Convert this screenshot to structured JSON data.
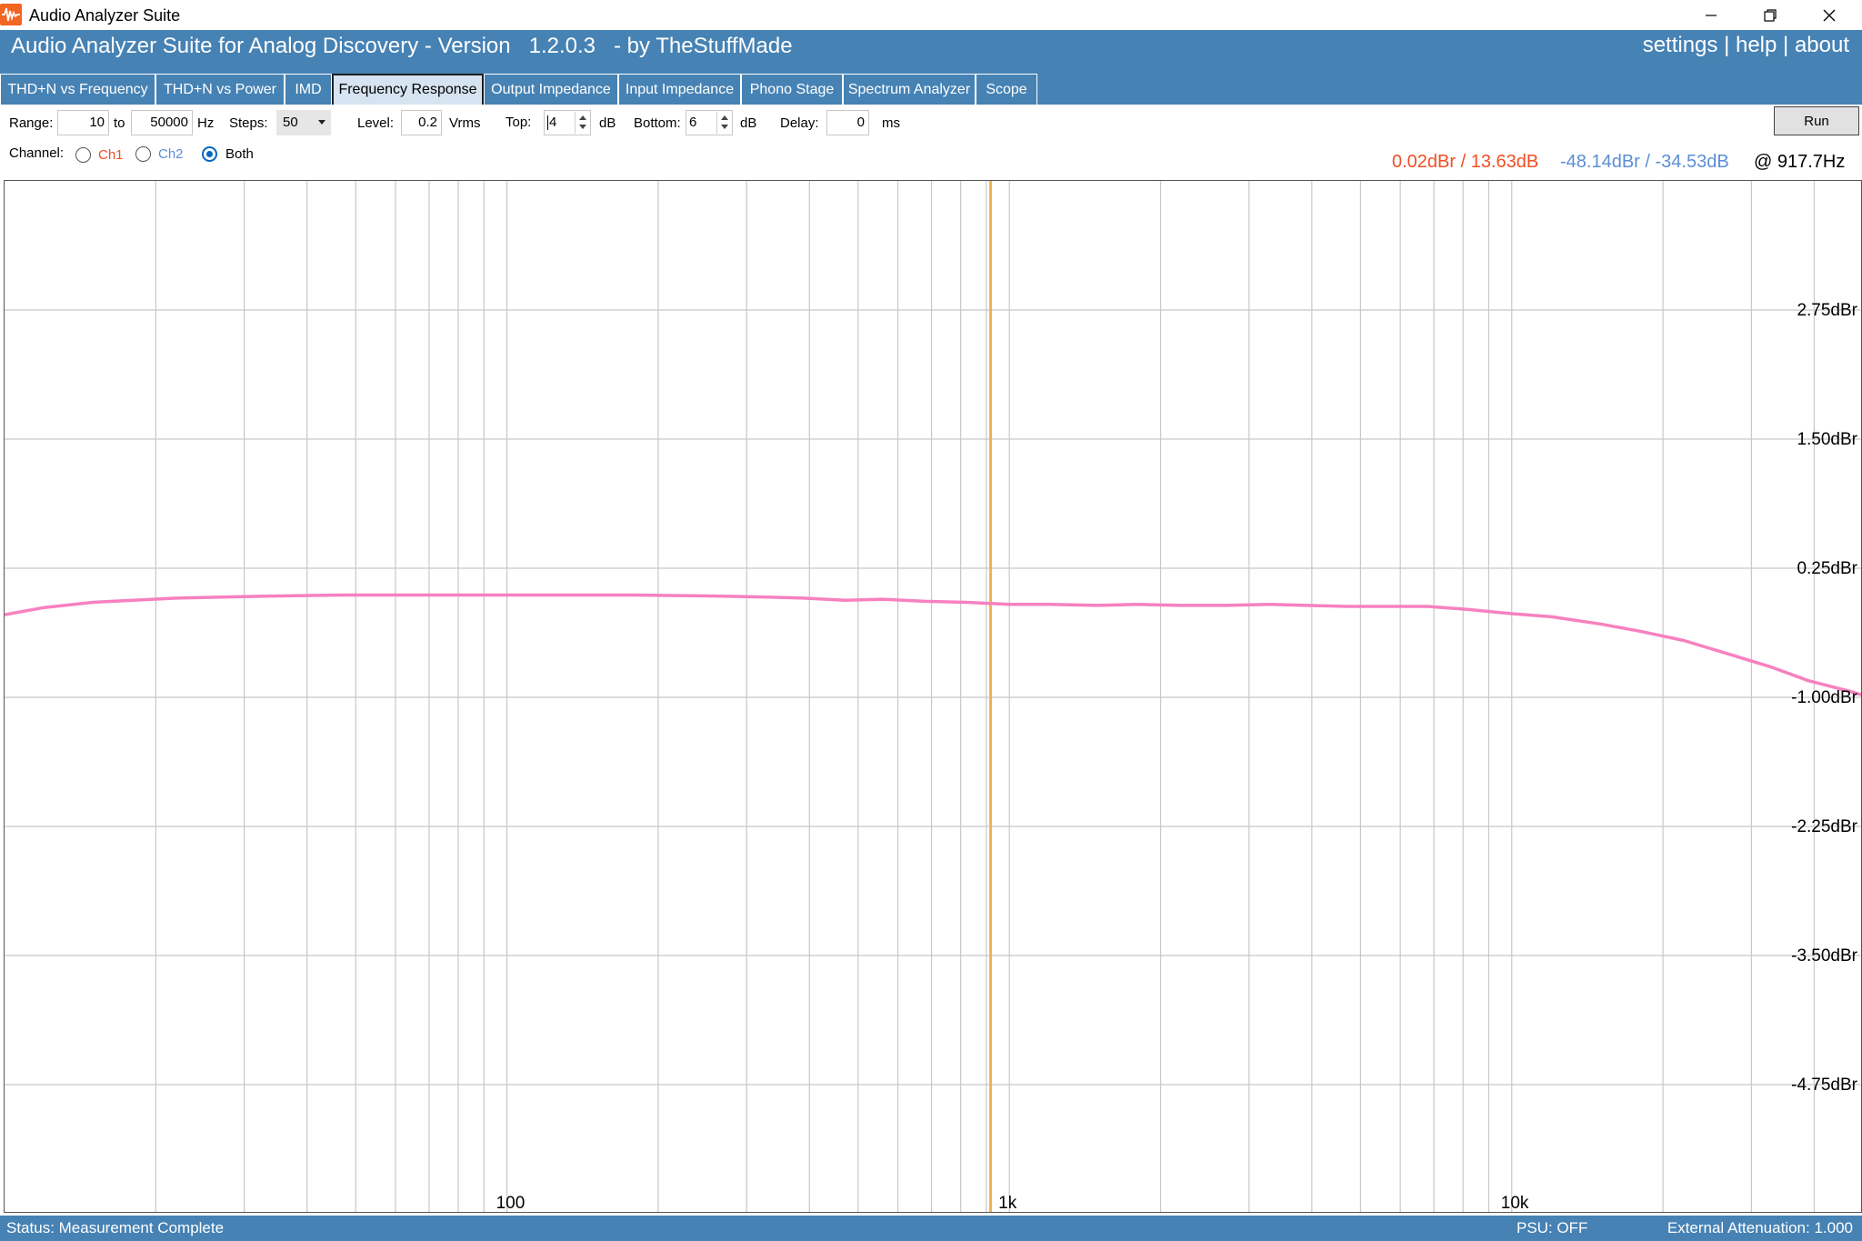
{
  "window": {
    "title": "Audio Analyzer Suite",
    "app_icon": "waveform-icon",
    "minimize_icon": "minimize-icon",
    "restore_icon": "restore-icon",
    "close_icon": "close-icon"
  },
  "header": {
    "title": "Audio Analyzer Suite for Analog Discovery - Version   1.2.0.3   - by TheStuffMade",
    "links": {
      "settings": "settings",
      "sep1": " | ",
      "help": "help",
      "sep2": " | ",
      "about": "about"
    },
    "color": "#4682b4"
  },
  "tabs": [
    {
      "label": "THD+N vs Frequency",
      "active": false
    },
    {
      "label": "THD+N vs Power",
      "active": false
    },
    {
      "label": "IMD",
      "active": false
    },
    {
      "label": "Frequency Response",
      "active": true
    },
    {
      "label": "Output Impedance",
      "active": false
    },
    {
      "label": "Input Impedance",
      "active": false
    },
    {
      "label": "Phono Stage",
      "active": false
    },
    {
      "label": "Spectrum Analyzer",
      "active": false
    },
    {
      "label": "Scope",
      "active": false
    }
  ],
  "controls": {
    "range_label": "Range:",
    "range_from": "10",
    "range_to_label": "to",
    "range_to": "50000",
    "range_unit": "Hz",
    "steps_label": "Steps:",
    "steps_value": "50",
    "level_label": "Level:",
    "level_value": "0.2",
    "level_unit": "Vrms",
    "top_label": "Top:",
    "top_value": "4",
    "top_unit": "dB",
    "bottom_label": "Bottom:",
    "bottom_value": "6",
    "bottom_unit": "dB",
    "delay_label": "Delay:",
    "delay_value": "0",
    "delay_unit": "ms",
    "run_label": "Run",
    "channel_label": "Channel:",
    "channels": [
      {
        "label": "Ch1",
        "color": "#f04e23",
        "checked": false
      },
      {
        "label": "Ch2",
        "color": "#5b8fd6",
        "checked": false
      },
      {
        "label": "Both",
        "color": "#000000",
        "checked": true
      }
    ]
  },
  "readout": {
    "ch1": "0.02dBr / 13.63dB",
    "ch1_color": "#f04e23",
    "ch2": "-48.14dBr / -34.53dB",
    "ch2_color": "#5b8fd6",
    "freq": "@ 917.7Hz"
  },
  "chart_data": {
    "type": "line",
    "x_scale": "log",
    "xlim": [
      10,
      50000
    ],
    "ylim": [
      -6,
      4
    ],
    "y_ticks": [
      {
        "value": 2.75,
        "label": "2.75dBr"
      },
      {
        "value": 1.5,
        "label": "1.50dBr"
      },
      {
        "value": 0.25,
        "label": "0.25dBr"
      },
      {
        "value": -1.0,
        "label": "-1.00dBr"
      },
      {
        "value": -2.25,
        "label": "-2.25dBr"
      },
      {
        "value": -3.5,
        "label": "-3.50dBr"
      },
      {
        "value": -4.75,
        "label": "-4.75dBr"
      }
    ],
    "x_ticks": [
      {
        "value": 100,
        "label": "100"
      },
      {
        "value": 1000,
        "label": "1k"
      },
      {
        "value": 10000,
        "label": "10k"
      }
    ],
    "grid": true,
    "cursor_x": 917.7,
    "cursor_color": "#f2b150",
    "series": [
      {
        "color": "#f781bf",
        "x": [
          10,
          12,
          15,
          18,
          22,
          27,
          33,
          39,
          47,
          56,
          68,
          82,
          100,
          120,
          150,
          180,
          220,
          270,
          330,
          390,
          470,
          560,
          680,
          820,
          1000,
          1200,
          1500,
          1800,
          2200,
          2700,
          3300,
          3900,
          4700,
          5600,
          6800,
          8200,
          10000,
          12000,
          15000,
          18000,
          22000,
          27000,
          33000,
          39000,
          47000,
          50000
        ],
        "y": [
          -0.2,
          -0.13,
          -0.08,
          -0.06,
          -0.04,
          -0.03,
          -0.02,
          -0.015,
          -0.01,
          -0.01,
          -0.01,
          -0.01,
          -0.01,
          -0.01,
          -0.01,
          -0.01,
          -0.015,
          -0.02,
          -0.03,
          -0.04,
          -0.06,
          -0.05,
          -0.07,
          -0.08,
          -0.1,
          -0.1,
          -0.11,
          -0.1,
          -0.11,
          -0.11,
          -0.1,
          -0.11,
          -0.12,
          -0.12,
          -0.12,
          -0.15,
          -0.19,
          -0.22,
          -0.29,
          -0.36,
          -0.45,
          -0.58,
          -0.71,
          -0.84,
          -0.94,
          -0.98
        ]
      }
    ]
  },
  "status": {
    "left": "Status: Measurement Complete",
    "psu": "PSU: OFF",
    "attenuation": "External Attenuation: 1.000"
  }
}
